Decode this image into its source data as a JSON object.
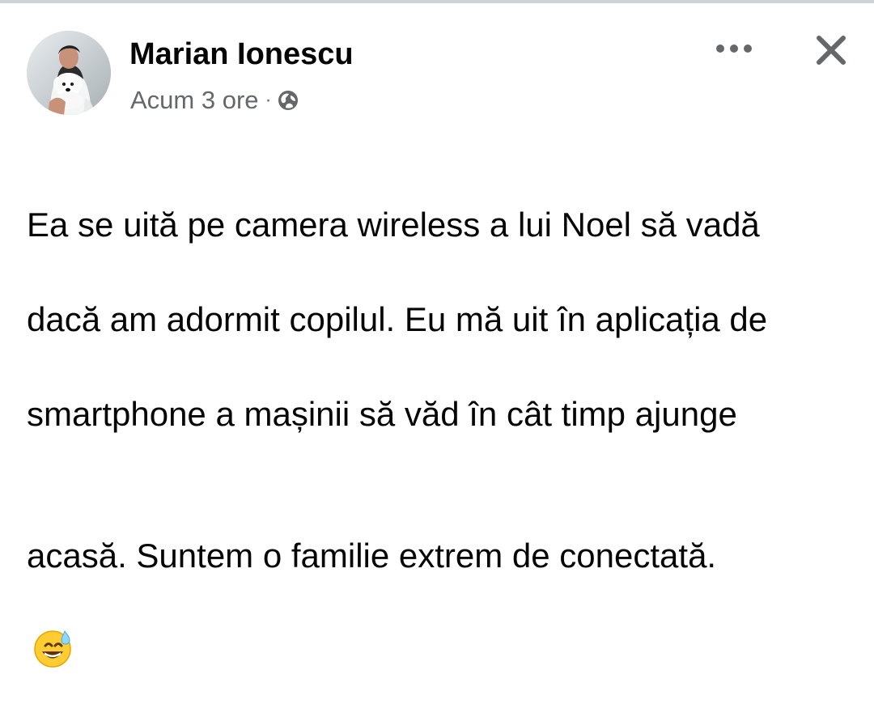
{
  "post": {
    "author": "Marian Ionescu",
    "time": "Acum 3 ore",
    "separator": "·",
    "audience_icon": "globe-icon",
    "body_lines": [
      "Ea se uită pe camera wireless a lui Noel să vadă",
      "dacă am adormit copilul. Eu mă uit în aplicația de",
      "smartphone a mașinii să văd în cât timp ajunge",
      "acasă.  Suntem o familie extrem de conectată."
    ],
    "trailing_emoji": "grinning-face-with-sweat-emoji"
  },
  "actions": {
    "more_icon": "more-horizontal-icon",
    "close_icon": "close-icon"
  },
  "colors": {
    "text": "#050505",
    "secondary_text": "#65676b",
    "top_strip": "#cfd2d6",
    "background": "#ffffff"
  }
}
